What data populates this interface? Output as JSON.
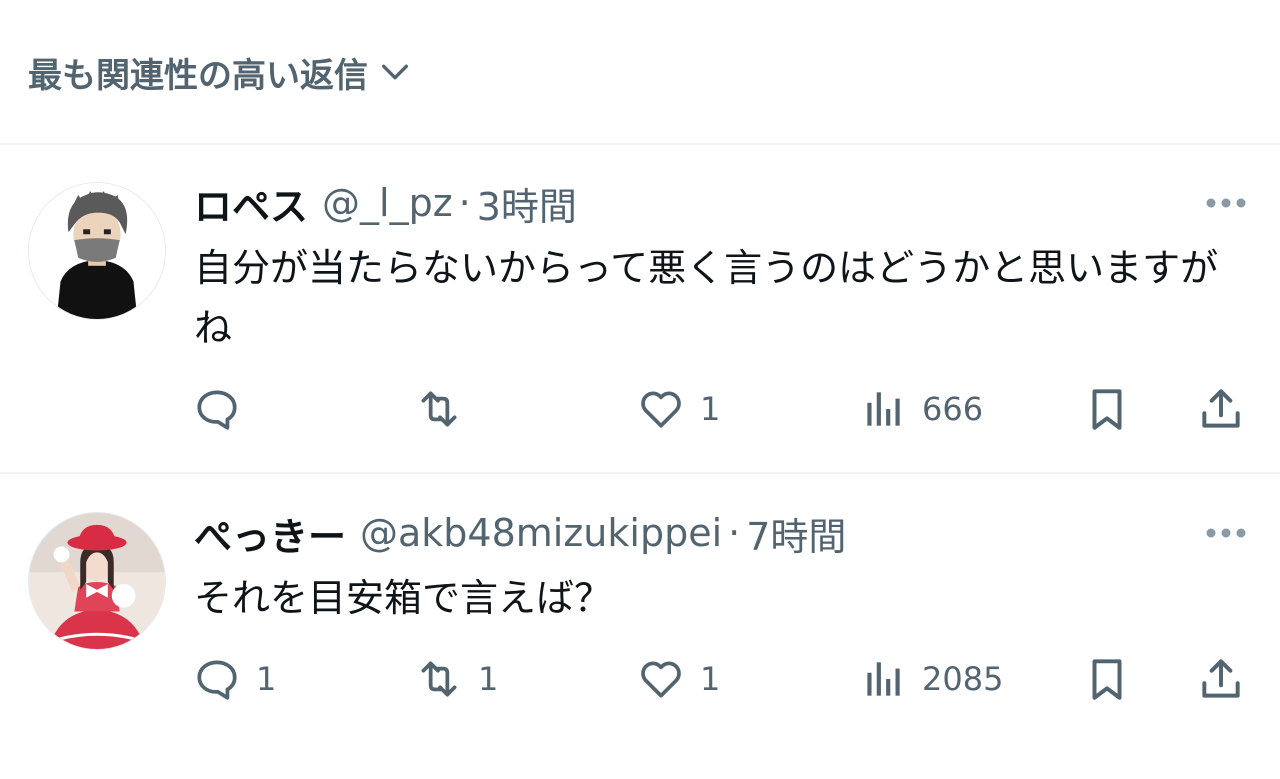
{
  "sort": {
    "label": "最も関連性の高い返信",
    "chevron_icon": "chevron-down-icon"
  },
  "replies": [
    {
      "display_name": "ロペス",
      "handle": "@_l_pz",
      "separator": "·",
      "time": "3時間",
      "text": "自分が当たらないからって悪く言うのはどうかと思いますがね",
      "avatar": "avatar-illustration-masked-man",
      "stats": {
        "replies": "",
        "reposts": "",
        "likes": "1",
        "views": "666"
      }
    },
    {
      "display_name": "ぺっきー",
      "handle": "@akb48mizukippei",
      "separator": "·",
      "time": "7時間",
      "text": "それを目安箱で言えば？",
      "avatar": "avatar-photo-red-costume",
      "stats": {
        "replies": "1",
        "reposts": "1",
        "likes": "1",
        "views": "2085"
      }
    }
  ],
  "colors": {
    "text_primary": "#0f1419",
    "text_secondary": "#536471",
    "divider": "#eff3f4"
  }
}
